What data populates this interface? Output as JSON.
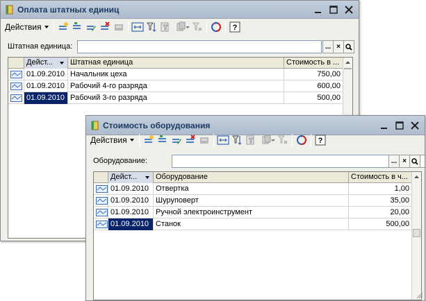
{
  "window1": {
    "title": "Оплата штатных единиц",
    "toolbar": {
      "actions_label": "Действия"
    },
    "filter": {
      "label": "Штатная единица:",
      "value": "",
      "browse_label": "...",
      "clear_label": "×"
    },
    "columns": [
      "Дейст...",
      "Штатная единица",
      "Стоимость в ..."
    ],
    "rows": [
      {
        "date": "01.09.2010",
        "name": "Начальник цеха",
        "cost": "750,00"
      },
      {
        "date": "01.09.2010",
        "name": "Рабочий 4-го разряда",
        "cost": "600,00"
      },
      {
        "date": "01.09.2010",
        "name": "Рабочий 3-го разряда",
        "cost": "500,00"
      }
    ]
  },
  "window2": {
    "title": "Стоимость оборудования",
    "toolbar": {
      "actions_label": "Действия"
    },
    "filter": {
      "label": "Оборудование:",
      "value": "",
      "browse_label": "...",
      "clear_label": "×"
    },
    "columns": [
      "Дейст...",
      "Оборудование",
      "Стоимость в ч..."
    ],
    "rows": [
      {
        "date": "01.09.2010",
        "name": "Отвертка",
        "cost": "1,00"
      },
      {
        "date": "01.09.2010",
        "name": "Шуруповерт",
        "cost": "35,00"
      },
      {
        "date": "01.09.2010",
        "name": "Ручной электроинструмент",
        "cost": "20,00"
      },
      {
        "date": "01.09.2010",
        "name": "Станок",
        "cost": "500,00"
      }
    ]
  },
  "icons": {
    "title": "document-book-icon",
    "row": "record-icon",
    "toolbar": [
      "add-icon",
      "copy-icon",
      "edit-icon",
      "delete-icon",
      "post-icon",
      "select-period-icon",
      "filter-icon",
      "filter-list-icon",
      "sort-icon",
      "clear-filter-icon",
      "refresh-icon",
      "help-icon"
    ]
  },
  "colors": {
    "selection": "#0a246a",
    "title_text": "#1b3a63",
    "window_bg": "#f0f0ea"
  }
}
